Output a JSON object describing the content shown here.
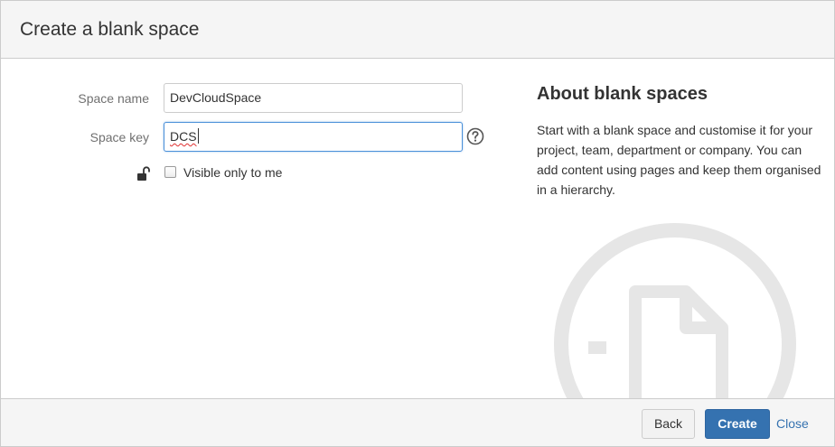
{
  "dialog": {
    "title": "Create a blank space"
  },
  "form": {
    "space_name_label": "Space name",
    "space_name_value": "DevCloudSpace",
    "space_key_label": "Space key",
    "space_key_value": "DCS",
    "visibility_label": "Visible only to me",
    "visibility_checked": false
  },
  "about": {
    "title": "About blank spaces",
    "text": "Start with a blank space and customise it for your project, team, department or company. You can add content using pages and keep them organised in a hierarchy."
  },
  "footer": {
    "back_label": "Back",
    "create_label": "Create",
    "close_label": "Close"
  },
  "icons": {
    "help": "help-icon",
    "lock": "unlock-icon",
    "watermark": "blank-page-icon"
  },
  "colors": {
    "primary": "#3572b0",
    "link": "#3572b0",
    "focus_border": "#4a90d9",
    "header_bg": "#f5f5f5"
  }
}
